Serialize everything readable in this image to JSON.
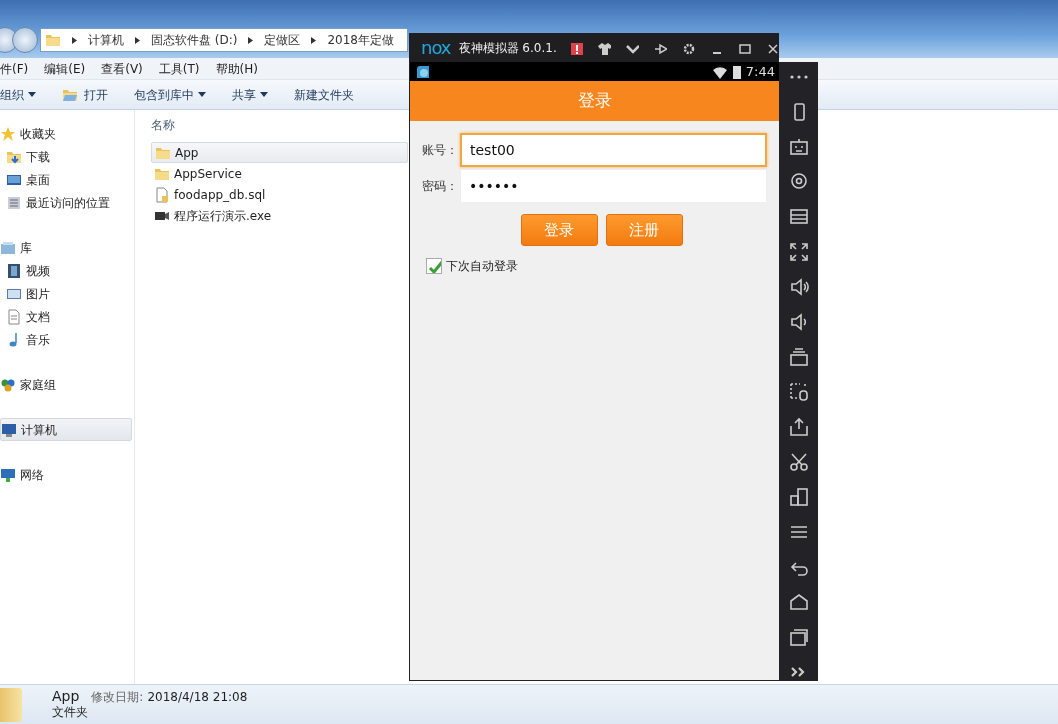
{
  "explorer": {
    "breadcrumb": [
      "计算机",
      "固态软件盘 (D:)",
      "定做区",
      "2018年定做"
    ],
    "menu": [
      "件(F)",
      "编辑(E)",
      "查看(V)",
      "工具(T)",
      "帮助(H)"
    ],
    "toolbar": [
      {
        "label": "组织",
        "dropdown": true
      },
      {
        "label": "打开",
        "dropdown": false,
        "kind": "open"
      },
      {
        "label": "包含到库中",
        "dropdown": true
      },
      {
        "label": "共享",
        "dropdown": true
      },
      {
        "label": "新建文件夹",
        "dropdown": false
      }
    ],
    "nav": [
      {
        "label": "收藏夹",
        "kind": "star",
        "selected": false,
        "children": [
          {
            "label": "下载",
            "kind": "download",
            "selected": false
          },
          {
            "label": "桌面",
            "kind": "desktop",
            "selected": false
          },
          {
            "label": "最近访问的位置",
            "kind": "recent",
            "selected": false
          }
        ]
      },
      {
        "label": "库",
        "kind": "library",
        "selected": false,
        "children": [
          {
            "label": "视频",
            "kind": "video",
            "selected": false
          },
          {
            "label": "图片",
            "kind": "picture",
            "selected": false
          },
          {
            "label": "文档",
            "kind": "document",
            "selected": false
          },
          {
            "label": "音乐",
            "kind": "music",
            "selected": false
          }
        ]
      },
      {
        "label": "家庭组",
        "kind": "homegroup",
        "selected": false
      },
      {
        "label": "计算机",
        "kind": "computer",
        "selected": true
      },
      {
        "label": "网络",
        "kind": "network",
        "selected": false
      }
    ],
    "column_header": "名称",
    "files": [
      {
        "name": "App",
        "kind": "folder",
        "selected": true
      },
      {
        "name": "AppService",
        "kind": "folder",
        "selected": false
      },
      {
        "name": "foodapp_db.sql",
        "kind": "file",
        "selected": false
      },
      {
        "name": "程序运行演示.exe",
        "kind": "exe",
        "selected": false
      }
    ],
    "details": {
      "name": "App",
      "modified_label": "修改日期:",
      "modified": "2018/4/18 21:08",
      "type": "文件夹"
    }
  },
  "emulator": {
    "logo": "nox",
    "title": "夜神模拟器 6.0.1.",
    "time": "7:44",
    "app_title": "登录",
    "fields": [
      {
        "label": "账号：",
        "value": "test00",
        "focused": true
      },
      {
        "label": "密码：",
        "value": "••••••",
        "focused": false
      }
    ],
    "buttons": [
      "登录",
      "注册"
    ],
    "remember": {
      "label": "下次自动登录",
      "checked": true
    }
  }
}
